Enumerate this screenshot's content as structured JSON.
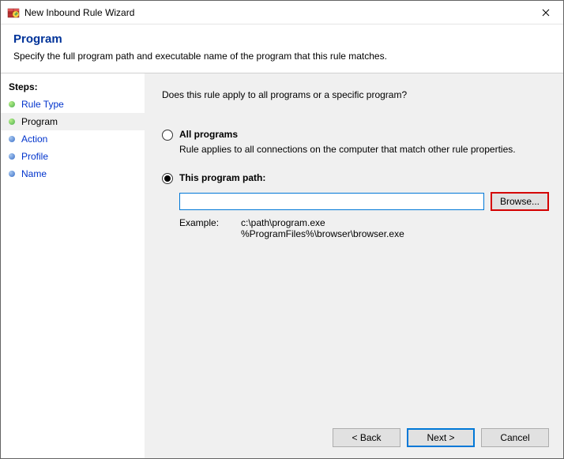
{
  "title": "New Inbound Rule Wizard",
  "header": {
    "title": "Program",
    "desc": "Specify the full program path and executable name of the program that this rule matches."
  },
  "sidebar": {
    "title": "Steps:",
    "items": [
      {
        "label": "Rule Type",
        "bullet": "green",
        "current": false
      },
      {
        "label": "Program",
        "bullet": "green",
        "current": true
      },
      {
        "label": "Action",
        "bullet": "blue",
        "current": false
      },
      {
        "label": "Profile",
        "bullet": "blue",
        "current": false
      },
      {
        "label": "Name",
        "bullet": "blue",
        "current": false
      }
    ]
  },
  "content": {
    "question": "Does this rule apply to all programs or a specific program?",
    "allPrograms": {
      "label": "All programs",
      "desc": "Rule applies to all connections on the computer that match other rule properties."
    },
    "thisProgram": {
      "label": "This program path:",
      "value": "",
      "browse": "Browse...",
      "exampleLabel": "Example:",
      "example": "c:\\path\\program.exe\n%ProgramFiles%\\browser\\browser.exe"
    }
  },
  "footer": {
    "back": "< Back",
    "next": "Next >",
    "cancel": "Cancel"
  }
}
